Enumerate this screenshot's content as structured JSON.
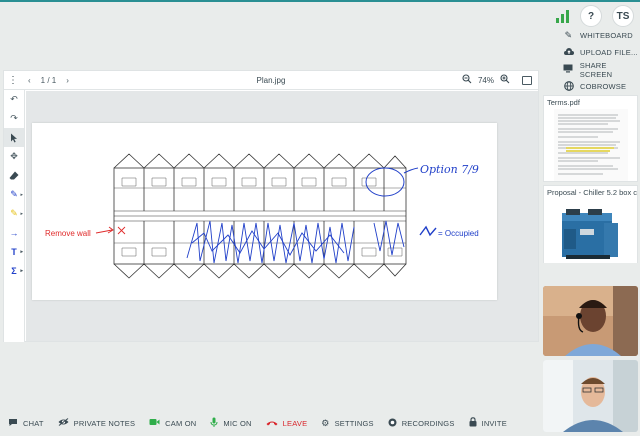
{
  "header": {
    "help_label": "?",
    "user_initials": "TS"
  },
  "side_menu": [
    {
      "label": "WHITEBOARD",
      "icon": "pencil-icon"
    },
    {
      "label": "UPLOAD FILE...",
      "icon": "upload-icon"
    },
    {
      "label": "SHARE SCREEN",
      "icon": "monitor-icon"
    },
    {
      "label": "COBROWSE",
      "icon": "globe-icon"
    }
  ],
  "viewer": {
    "page_indicator": "1 / 1",
    "title": "Plan.jpg",
    "zoom": "74%"
  },
  "annotations": {
    "remove_wall": "Remove wall",
    "option": "Option 7/9",
    "occupied": "= Occupied"
  },
  "documents": [
    {
      "title": "Terms.pdf"
    },
    {
      "title": "Proposal - Chiller 5.2 box co..."
    }
  ],
  "bottom_bar": {
    "chat": "CHAT",
    "private_notes": "PRIVATE NOTES",
    "cam": "CAM ON",
    "mic": "MIC ON",
    "leave": "LEAVE",
    "settings": "SETTINGS",
    "recordings": "RECORDINGS",
    "invite": "INVITE"
  },
  "colors": {
    "accent": "#2a8f93",
    "ink_blue": "#2140c9",
    "ink_red": "#e02b2b",
    "cam_green": "#2fae4a",
    "leave_red": "#d9262c"
  }
}
